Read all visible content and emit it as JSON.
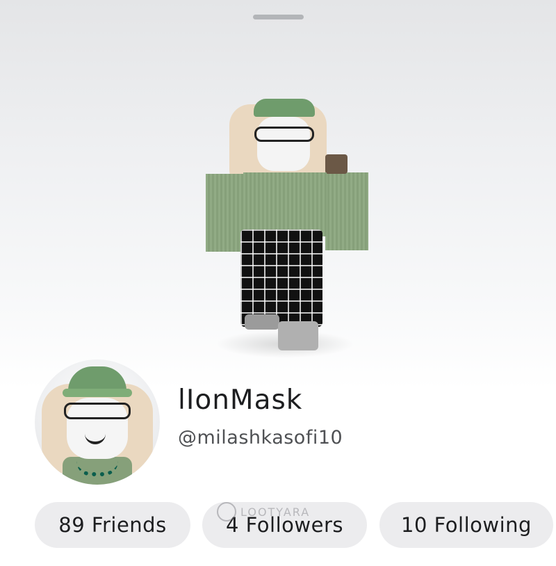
{
  "profile": {
    "display_name": "lIonMask",
    "username": "@milashkasofi10"
  },
  "stats": {
    "friends": "89 Friends",
    "followers": "4 Followers",
    "following": "10 Following"
  },
  "watermark": "LOOTYARA",
  "colors": {
    "pill_bg": "#ececee",
    "outfit_green": "#86a07a",
    "cap_green": "#6f9c6c"
  }
}
